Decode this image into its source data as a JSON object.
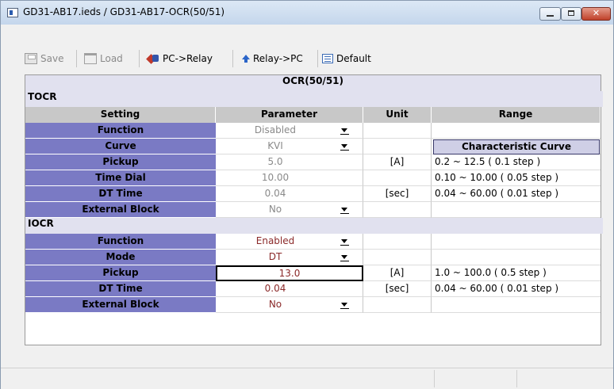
{
  "window": {
    "title": "GD31-AB17.ieds / GD31-AB17-OCR(50/51)"
  },
  "window_controls": {
    "minimize": "minimize",
    "maximize": "maximize",
    "close": "✕"
  },
  "toolbar": {
    "save_label": "Save",
    "load_label": "Load",
    "pc_relay_label": "PC->Relay",
    "relay_pc_label": "Relay->PC",
    "default_label": "Default"
  },
  "grid": {
    "title": "OCR(50/51)",
    "headers": {
      "setting": "Setting",
      "parameter": "Parameter",
      "unit": "Unit",
      "range": "Range"
    },
    "characteristic_curve_label": "Characteristic Curve",
    "sections": [
      {
        "name": "TOCR",
        "rows": [
          {
            "setting": "Function",
            "value": "Disabled",
            "unit": "",
            "range": "",
            "dropdown": true
          },
          {
            "setting": "Curve",
            "value": "KVI",
            "unit": "",
            "range": "",
            "dropdown": true
          },
          {
            "setting": "Pickup",
            "value": "5.0",
            "unit": "[A]",
            "range": "0.2 ~ 12.5 ( 0.1 step )"
          },
          {
            "setting": "Time Dial",
            "value": "10.00",
            "unit": "",
            "range": "0.10 ~ 10.00 ( 0.05 step )"
          },
          {
            "setting": "DT Time",
            "value": "0.04",
            "unit": "[sec]",
            "range": "0.04 ~ 60.00 ( 0.01 step )"
          },
          {
            "setting": "External Block",
            "value": "No",
            "unit": "",
            "range": "",
            "dropdown": true
          }
        ]
      },
      {
        "name": "IOCR",
        "rows": [
          {
            "setting": "Function",
            "value": "Enabled",
            "unit": "",
            "range": "",
            "dropdown": true
          },
          {
            "setting": "Mode",
            "value": "DT",
            "unit": "",
            "range": "",
            "dropdown": true
          },
          {
            "setting": "Pickup",
            "value": "13.0",
            "unit": "[A]",
            "range": "1.0 ~ 100.0 ( 0.5 step )"
          },
          {
            "setting": "DT Time",
            "value": "0.04",
            "unit": "[sec]",
            "range": "0.04 ~ 60.00 ( 0.01 step )"
          },
          {
            "setting": "External Block",
            "value": "No",
            "unit": "",
            "range": "",
            "dropdown": true
          }
        ]
      }
    ]
  },
  "colors": {
    "label_bg": "#7a7ac4",
    "section_bg": "#e1e1ef",
    "header_bg": "#c8c8c8",
    "enabled_text": "#8b2a2a",
    "disabled_text": "#8a8a8a"
  }
}
